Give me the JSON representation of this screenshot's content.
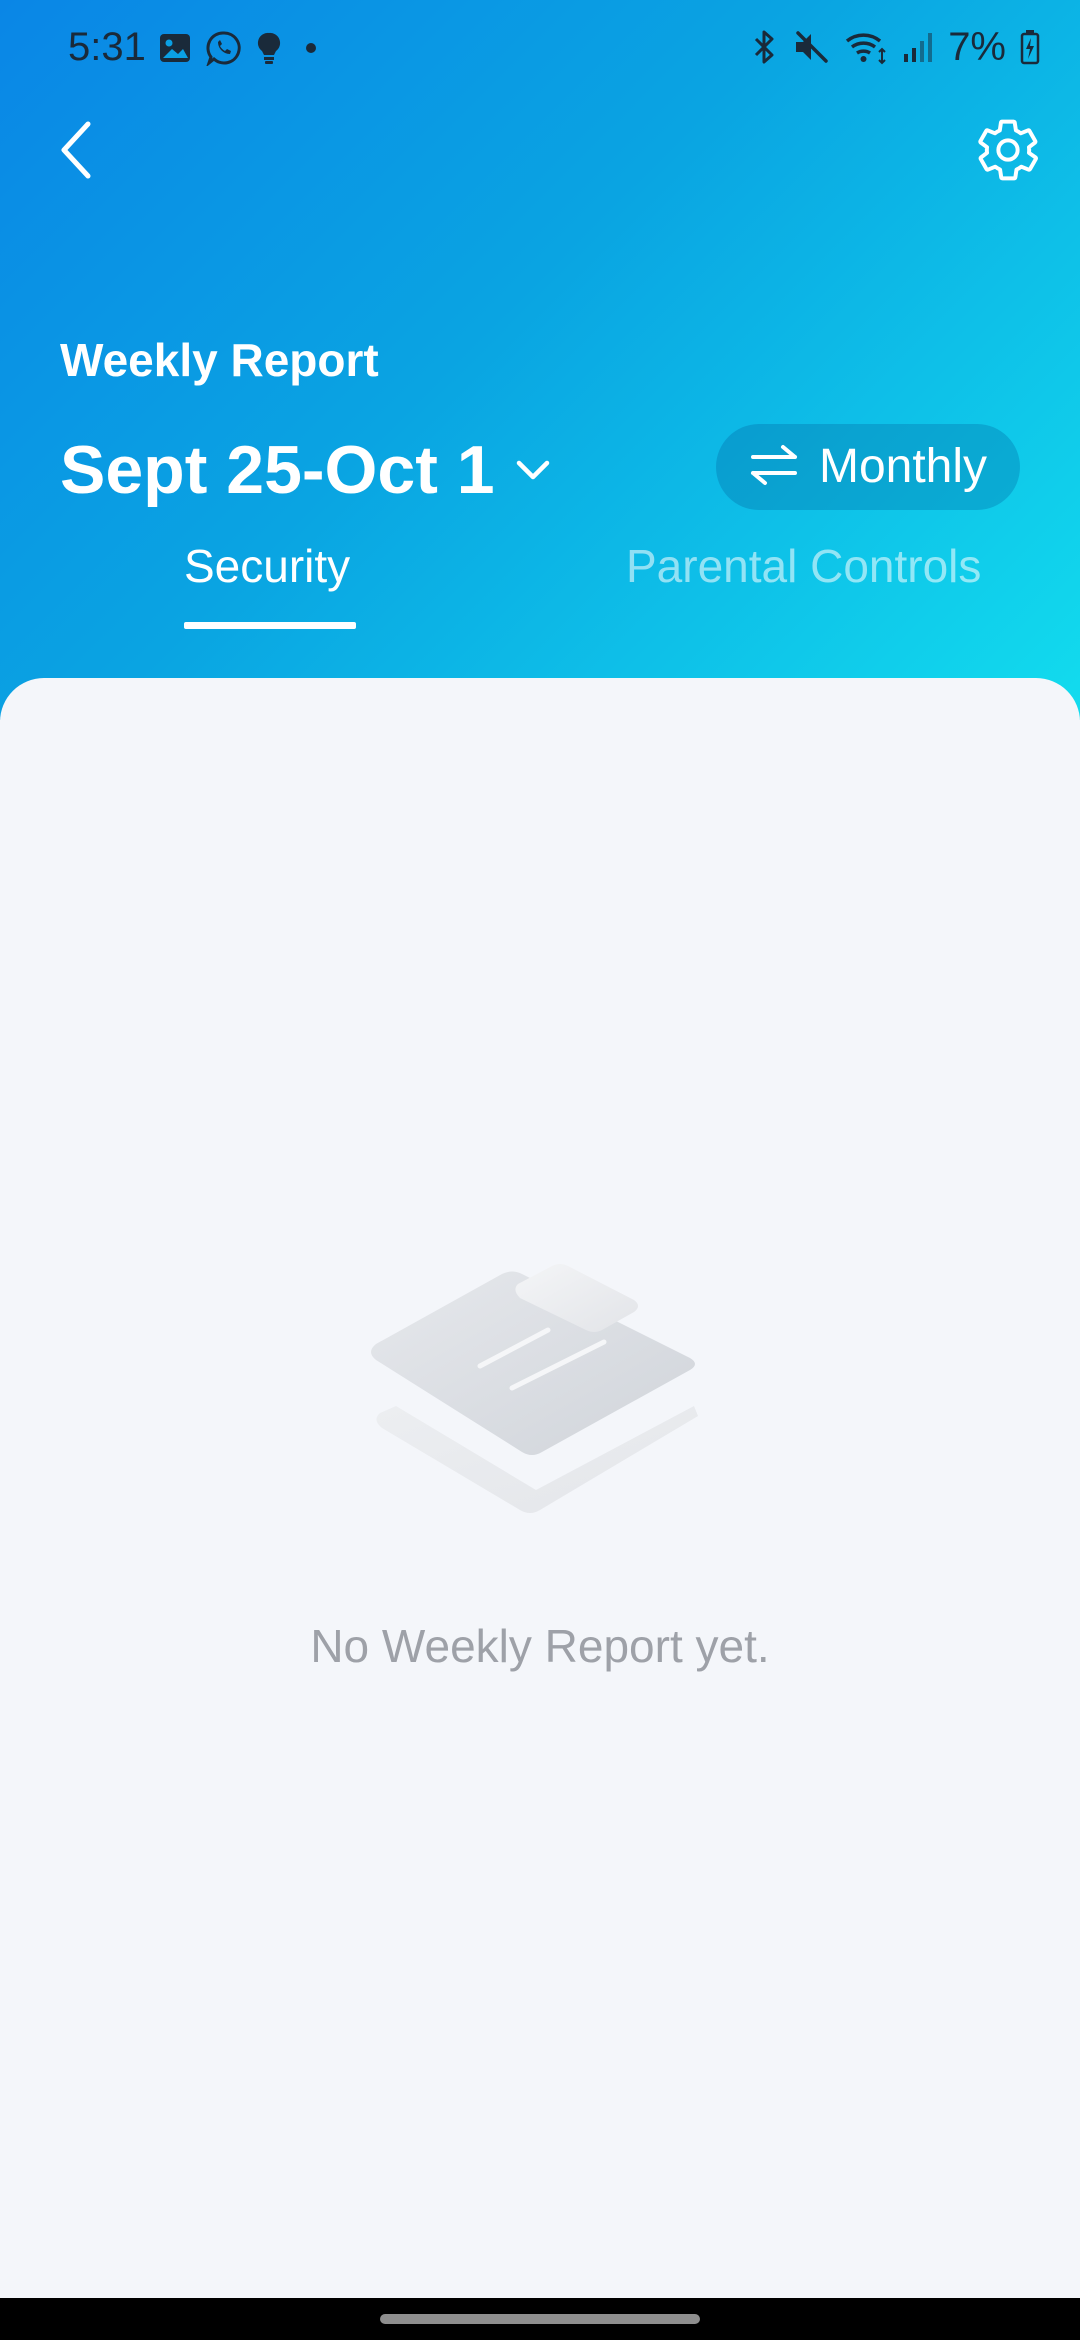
{
  "status_bar": {
    "time": "5:31",
    "left_icons": [
      "gallery-icon",
      "whatsapp-icon",
      "bulb-icon",
      "dot-icon"
    ],
    "right_icons": [
      "bluetooth-icon",
      "mute-icon",
      "wifi-icon",
      "signal-icon",
      "battery-icon"
    ],
    "battery": "7%"
  },
  "header": {
    "back_icon": "chevron-left-icon",
    "settings_icon": "gear-icon",
    "report_title": "Weekly Report",
    "date_range": "Sept 25-Oct 1",
    "toggle_label": "Monthly",
    "gradient_colors": [
      "#0a86e6",
      "#12dcee"
    ]
  },
  "tabs": [
    {
      "label": "Security",
      "active": true
    },
    {
      "label": "Parental Controls",
      "active": false
    }
  ],
  "empty_state": {
    "icon": "empty-report-illustration",
    "message": "No Weekly Report yet."
  }
}
